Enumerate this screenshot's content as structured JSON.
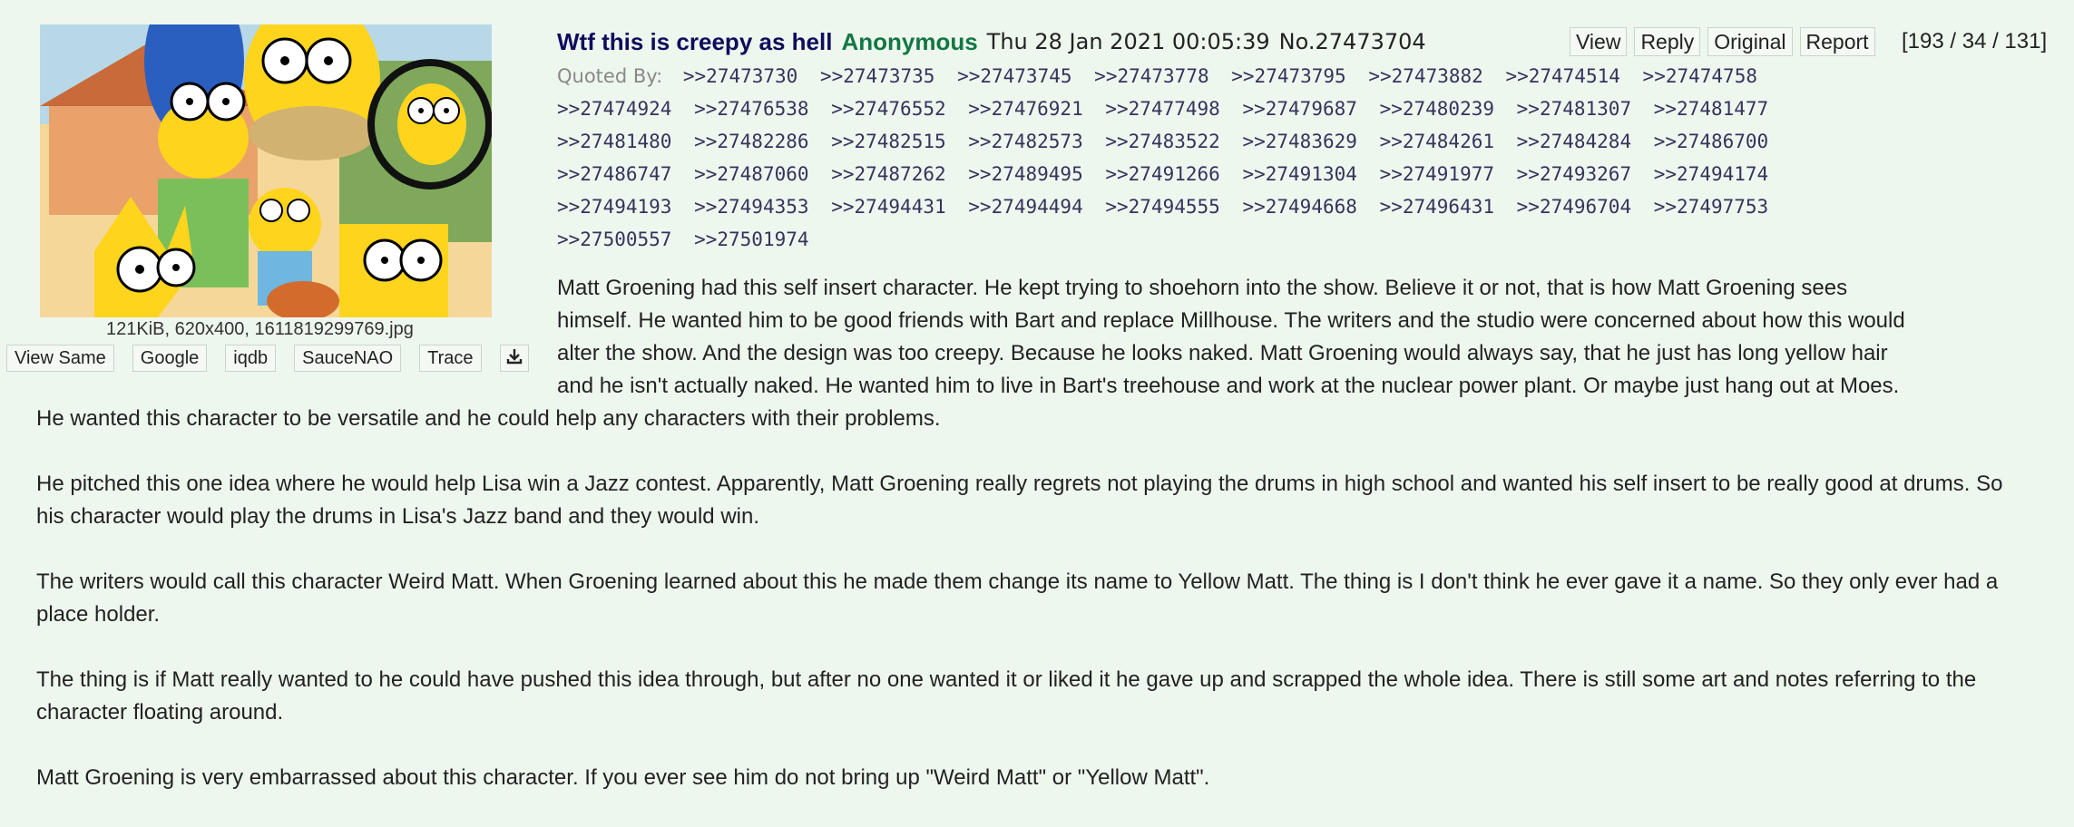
{
  "thumbnail": {
    "alt": "The Simpsons family artwork with a circled yellow character"
  },
  "file": {
    "info": "121KiB, 620x400, 1611819299769.jpg"
  },
  "search_buttons": [
    "View Same",
    "Google",
    "iqdb",
    "SauceNAO",
    "Trace"
  ],
  "download_icon": "download-icon",
  "post": {
    "subject": "Wtf this is creepy as hell",
    "name": "Anonymous",
    "date": "Thu 28 Jan 2021 00:05:39",
    "number": "No.27473704",
    "header_buttons": [
      "View",
      "Reply",
      "Original",
      "Report"
    ],
    "counts": "[193 / 34 / 131]"
  },
  "quoted_by": {
    "label": "Quoted By:",
    "links": [
      ">>27473730",
      ">>27473735",
      ">>27473745",
      ">>27473778",
      ">>27473795",
      ">>27473882",
      ">>27474514",
      ">>27474758",
      ">>27474924",
      ">>27476538",
      ">>27476552",
      ">>27476921",
      ">>27477498",
      ">>27479687",
      ">>27480239",
      ">>27481307",
      ">>27481477",
      ">>27481480",
      ">>27482286",
      ">>27482515",
      ">>27482573",
      ">>27483522",
      ">>27483629",
      ">>27484261",
      ">>27484284",
      ">>27486700",
      ">>27486747",
      ">>27487060",
      ">>27487262",
      ">>27489495",
      ">>27491266",
      ">>27491304",
      ">>27491977",
      ">>27493267",
      ">>27494174",
      ">>27494193",
      ">>27494353",
      ">>27494431",
      ">>27494494",
      ">>27494555",
      ">>27494668",
      ">>27496431",
      ">>27496704",
      ">>27497753",
      ">>27500557",
      ">>27501974"
    ]
  },
  "body": {
    "p1_lines": [
      "Matt Groening had this self insert character. He kept trying to shoehorn into the show. Believe it or not, that is how Matt Groening sees",
      "himself. He wanted him to be good friends with Bart and replace Millhouse. The writers and the studio were concerned about how this would",
      "alter the show. And the design was too creepy. Because he looks naked. Matt Groening would always say, that he just has long yellow hair",
      "and he isn't actually naked. He wanted him to live in Bart's treehouse and work at the nuclear power plant. Or maybe just hang out at Moes."
    ],
    "p1_tail": "He wanted this character to be versatile and he could help any characters with their problems.",
    "p2": "He pitched this one idea where he would help Lisa win a Jazz contest. Apparently, Matt Groening really regrets not playing the drums in high school and wanted his self insert to be really good at drums. So his character would play the drums in Lisa's Jazz band and they would win.",
    "p3": "The writers would call this character Weird Matt. When Groening learned about this he made them change its name to Yellow Matt. The thing is I don't think he ever gave it a name. So they only ever had a place holder.",
    "p4": "The thing is if Matt really wanted to he could have pushed this idea through, but after no one wanted it or liked it he gave up and scrapped the whole idea. There is still some art and notes referring to the character floating around.",
    "p5": "Matt Groening is very embarrassed about this character. If you ever see him do not bring up \"Weird Matt\" or \"Yellow Matt\"."
  }
}
